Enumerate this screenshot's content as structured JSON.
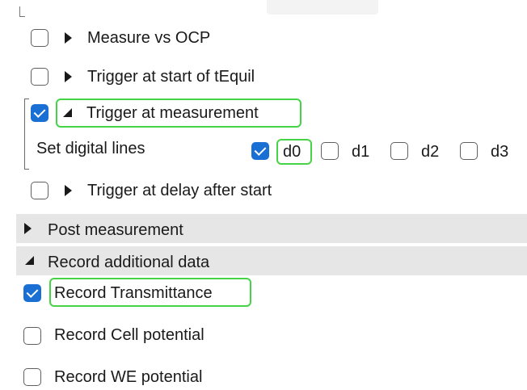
{
  "trigger_options": {
    "measure_vs_ocp": "Measure vs OCP",
    "trigger_start_tequil": "Trigger at start of tEquil",
    "trigger_at_measurement": "Trigger at measurement",
    "set_digital_lines": "Set digital lines",
    "digital_lines": [
      "d0",
      "d1",
      "d2",
      "d3"
    ],
    "trigger_delay_after_start": "Trigger at delay after start"
  },
  "sections": {
    "post_measurement": "Post measurement",
    "record_additional_data": "Record additional data"
  },
  "record_options": {
    "transmittance": "Record Transmittance",
    "cell_potential": "Record Cell potential",
    "we_potential": "Record WE potential"
  },
  "colors": {
    "checkbox_checked": "#1a6fd4",
    "highlight": "#46d446",
    "section_bg": "#e6e6e6"
  },
  "states": {
    "measure_vs_ocp": false,
    "trigger_start_tequil": false,
    "trigger_at_measurement": true,
    "d0": true,
    "d1": false,
    "d2": false,
    "d3": false,
    "trigger_delay_after_start": false,
    "record_transmittance": true,
    "record_cell_potential": false,
    "record_we_potential": false
  }
}
